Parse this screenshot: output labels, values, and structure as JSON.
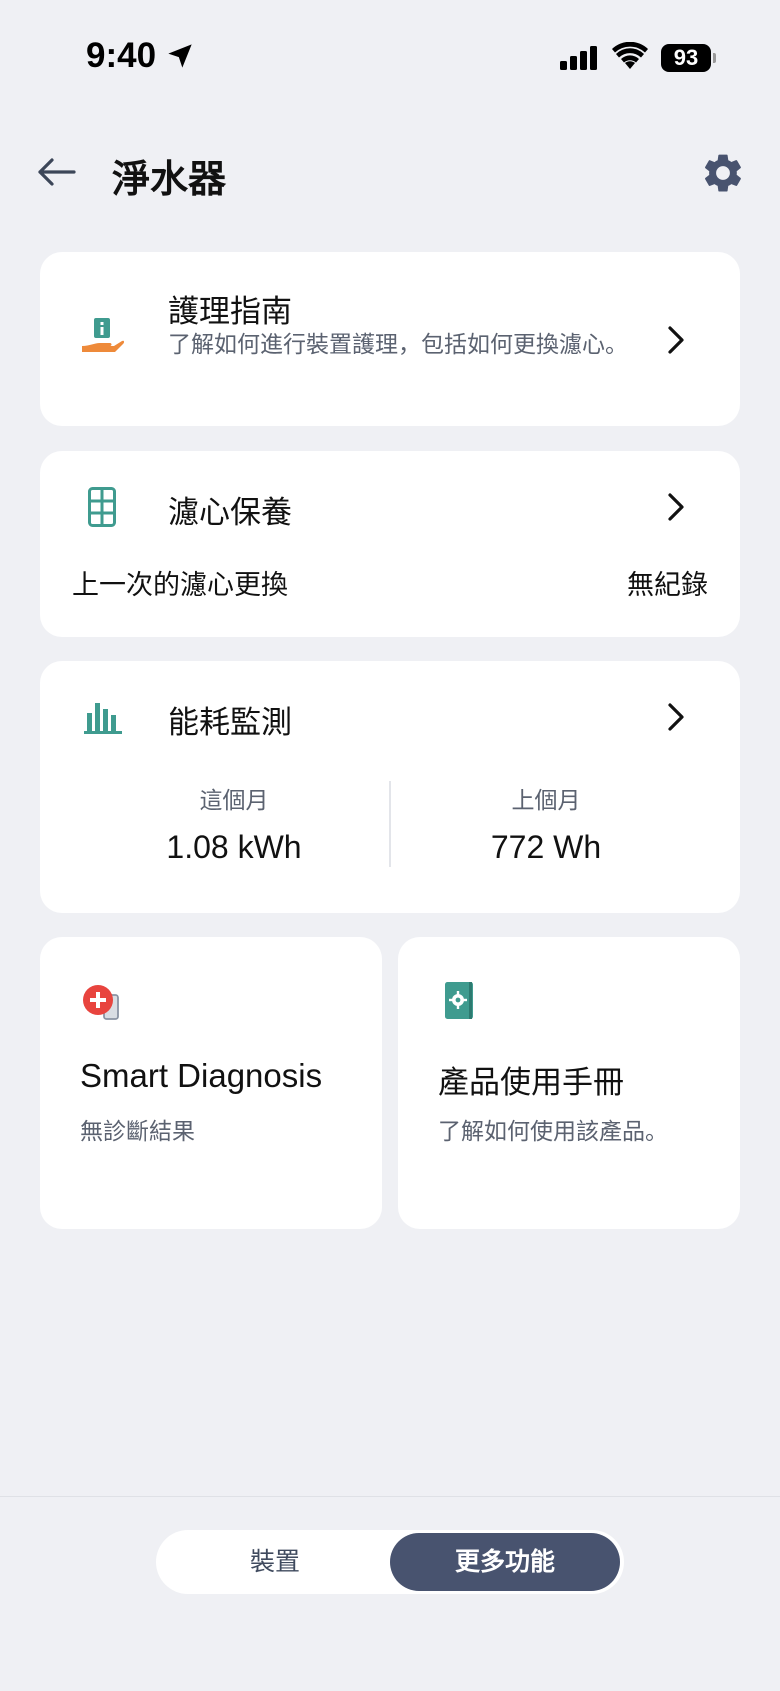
{
  "status_bar": {
    "time": "9:40",
    "battery": "93"
  },
  "header": {
    "title": "淨水器"
  },
  "care_guide": {
    "title": "護理指南",
    "description": "了解如何進行裝置護理，包括如何更換濾心。"
  },
  "filter": {
    "title": "濾心保養",
    "row_label": "上一次的濾心更換",
    "row_value": "無紀錄"
  },
  "energy": {
    "title": "能耗監測",
    "this_month_label": "這個月",
    "this_month_value": "1.08 kWh",
    "last_month_label": "上個月",
    "last_month_value": "772 Wh"
  },
  "diagnosis": {
    "title": "Smart Diagnosis",
    "status": "無診斷結果"
  },
  "manual": {
    "title": "產品使用手冊",
    "description": "了解如何使用該產品。"
  },
  "tabs": {
    "devices": "裝置",
    "more": "更多功能"
  },
  "colors": {
    "accent_teal": "#3f9b8f",
    "accent_orange": "#ee8a3a",
    "diag_red": "#e8443e",
    "segment_active": "#48536f"
  }
}
